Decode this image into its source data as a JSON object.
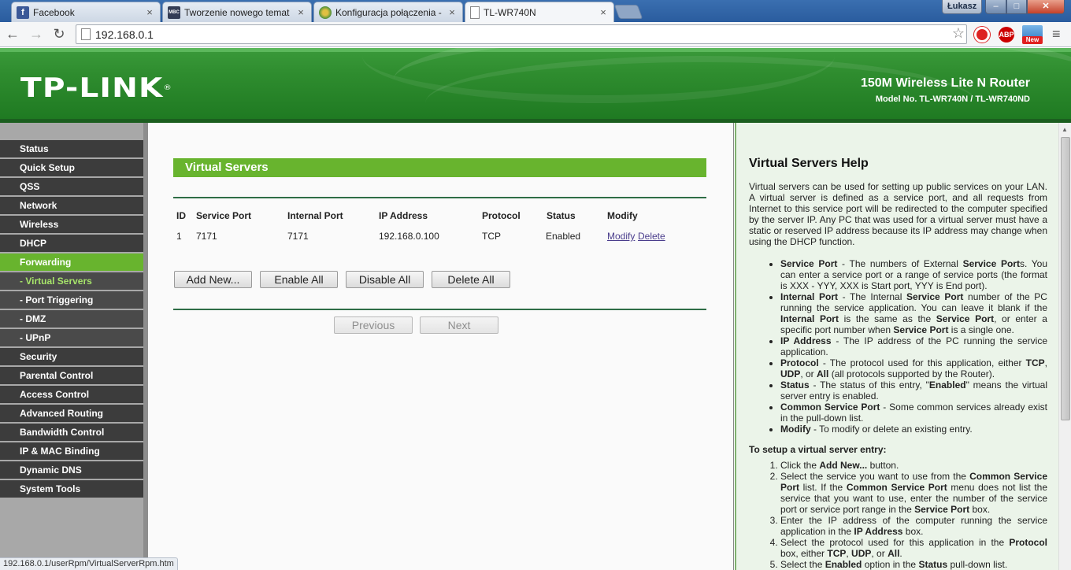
{
  "browser": {
    "tabs": [
      {
        "label": "Facebook",
        "icon": "facebook-icon",
        "icon_text": "f",
        "icon_color": "#3b5998"
      },
      {
        "label": "Tworzenie nowego temat",
        "icon": "forum-icon",
        "icon_text": "MBC",
        "icon_color": "#333c55"
      },
      {
        "label": "Konfiguracja połączenia -",
        "icon": "globe-icon",
        "icon_text": "",
        "icon_color": "#4a8f3a"
      },
      {
        "label": "TL-WR740N",
        "icon": "page-icon",
        "icon_text": "",
        "icon_color": "#ffffff"
      }
    ],
    "user": "Łukasz",
    "url": "192.168.0.1",
    "extensions": {
      "abp": "ABP",
      "new_badge": "New"
    },
    "status_url": "192.168.0.1/userRpm/VirtualServerRpm.htm"
  },
  "banner": {
    "logo": "TP-LINK",
    "product": "150M Wireless Lite N Router",
    "model": "Model No. TL-WR740N / TL-WR740ND",
    "brand_color": "#2f8d2f"
  },
  "menu": [
    {
      "label": "Status"
    },
    {
      "label": "Quick Setup"
    },
    {
      "label": "QSS"
    },
    {
      "label": "Network"
    },
    {
      "label": "Wireless"
    },
    {
      "label": "DHCP"
    },
    {
      "label": "Forwarding",
      "active": true
    },
    {
      "label": "- Virtual Servers",
      "sub": true,
      "current": true
    },
    {
      "label": "- Port Triggering",
      "sub": true
    },
    {
      "label": "- DMZ",
      "sub": true
    },
    {
      "label": "- UPnP",
      "sub": true
    },
    {
      "label": "Security"
    },
    {
      "label": "Parental Control"
    },
    {
      "label": "Access Control"
    },
    {
      "label": "Advanced Routing"
    },
    {
      "label": "Bandwidth Control"
    },
    {
      "label": "IP & MAC Binding"
    },
    {
      "label": "Dynamic DNS"
    },
    {
      "label": "System Tools"
    }
  ],
  "main": {
    "title": "Virtual Servers",
    "columns": [
      "ID",
      "Service Port",
      "Internal Port",
      "IP Address",
      "Protocol",
      "Status",
      "Modify"
    ],
    "rows": [
      {
        "id": "1",
        "service_port": "7171",
        "internal_port": "7171",
        "ip": "192.168.0.100",
        "protocol": "TCP",
        "status": "Enabled",
        "modify": "Modify",
        "delete": "Delete"
      }
    ],
    "buttons": {
      "add_new": "Add New...",
      "enable_all": "Enable All",
      "disable_all": "Disable All",
      "delete_all": "Delete All"
    },
    "pager": {
      "previous": "Previous",
      "next": "Next"
    }
  },
  "help": {
    "title": "Virtual Servers Help",
    "intro": "Virtual servers can be used for setting up public services on your LAN. A virtual server is defined as a service port, and all requests from Internet to this service port will be redirected to the computer specified by the server IP. Any PC that was used for a virtual server must have a static or reserved IP address because its IP address may change when using the DHCP function.",
    "items": [
      {
        "term": "Service Port",
        "text": " - The numbers of External Service Ports. You can enter a service port or a range of service ports (the format is XXX - YYY, XXX is Start port, YYY is End port)."
      },
      {
        "term": "Internal Port",
        "text": " - The Internal Service Port number of the PC running the service application. You can leave it blank if the Internal Port is the same as the Service Port, or enter a specific port number when Service Port is a single one."
      },
      {
        "term": "IP Address",
        "text": " - The IP address of the PC running the service application."
      },
      {
        "term": "Protocol",
        "text": " - The protocol used for this application, either TCP, UDP, or All (all protocols supported by the Router)."
      },
      {
        "term": "Status",
        "text": " - The status of this entry, \"Enabled\" means the virtual server entry is enabled."
      },
      {
        "term": "Common Service Port",
        "text": " - Some common services already exist in the pull-down list."
      },
      {
        "term": "Modify",
        "text": " - To modify or delete an existing entry."
      }
    ],
    "setup_title": "To setup a virtual server entry:",
    "steps": [
      "Click the Add New... button.",
      "Select the service you want to use from the Common Service Port list. If the Common Service Port menu does not list the service that you want to use, enter the number of the service port or service port range in the Service Port box.",
      "Enter the IP address of the computer running the service application in the IP Address box.",
      "Select the protocol used for this application in the Protocol box, either TCP, UDP, or All.",
      "Select the Enabled option in the Status pull-down list."
    ]
  }
}
